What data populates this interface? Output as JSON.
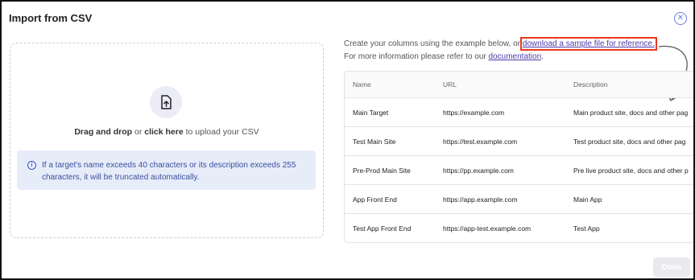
{
  "dialog": {
    "title": "Import from CSV",
    "done_label": "Done"
  },
  "dropzone": {
    "bold_lead": "Drag and drop",
    "or": " or ",
    "click_here": "click here",
    "tail": " to upload your CSV",
    "info": "If a target's name exceeds 40 characters or its description exceeds 255 characters, it will be truncated automatically."
  },
  "help": {
    "line1_prefix": "Create your columns using the example below, or ",
    "sample_link": "download a sample file for reference.",
    "line2_prefix": "For more information please refer to our ",
    "docs_link": "documentation",
    "line2_suffix": "."
  },
  "table": {
    "headers": [
      "Name",
      "URL",
      "Description"
    ],
    "rows": [
      [
        "Main Target",
        "https://example.com",
        "Main product site, docs and other pag"
      ],
      [
        "Test Main Site",
        "https://test.example.com",
        "Test product site, docs and other pag"
      ],
      [
        "Pre-Prod Main Site",
        "https://pp.example.com",
        "Pre live product site, docs and other p"
      ],
      [
        "App Front End",
        "https://app.example.com",
        "Main App"
      ],
      [
        "Test App Front End",
        "https://app-test.example.com",
        "Test App"
      ]
    ]
  },
  "colors": {
    "accent": "#4b3da8",
    "highlight": "#e8391b",
    "info_bg": "#e7ecf9"
  }
}
